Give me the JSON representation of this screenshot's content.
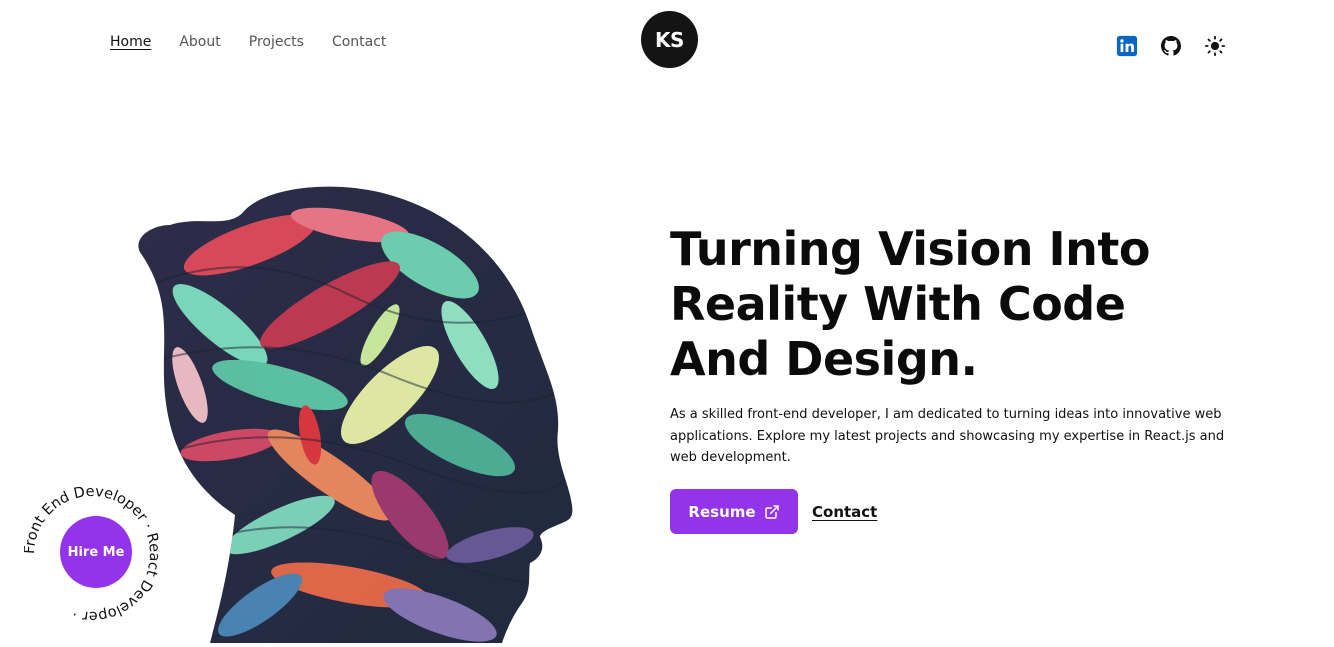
{
  "nav": {
    "items": [
      {
        "label": "Home",
        "active": true
      },
      {
        "label": "About",
        "active": false
      },
      {
        "label": "Projects",
        "active": false
      },
      {
        "label": "Contact",
        "active": false
      }
    ]
  },
  "logo": {
    "text": "KS"
  },
  "social": {
    "icons": [
      "linkedin-icon",
      "github-icon",
      "sun-icon"
    ]
  },
  "hero": {
    "headline": "Turning Vision Into Reality With Code And Design.",
    "description": "As a skilled front-end developer, I am dedicated to turning ideas into innovative web applications. Explore my latest projects and showcasing my expertise in React.js and web development.",
    "resume_label": "Resume",
    "contact_label": "Contact"
  },
  "hire": {
    "button_label": "Hire Me",
    "ring_text": "Front End Developer · React Developer · "
  },
  "colors": {
    "accent": "#9333ea",
    "dark": "#141414",
    "linkedin": "#0a66c2"
  }
}
